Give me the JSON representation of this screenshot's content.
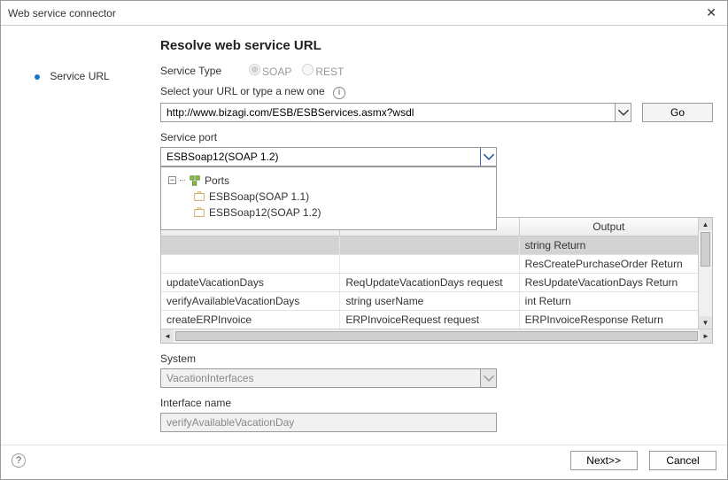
{
  "window": {
    "title": "Web service connector"
  },
  "nav": {
    "item0": "Service URL"
  },
  "section": {
    "title": "Resolve web service URL",
    "service_type_label": "Service Type",
    "service_type_options": {
      "soap": "SOAP",
      "rest": "REST"
    },
    "url_label": "Select your URL or type a new one",
    "url_value": "http://www.bizagi.com/ESB/ESBServices.asmx?wsdl",
    "go_label": "Go",
    "port_label": "Service port",
    "port_value": "ESBSoap12(SOAP 1.2)",
    "port_tree": {
      "root": "Ports",
      "items": [
        "ESBSoap(SOAP 1.1)",
        "ESBSoap12(SOAP 1.2)"
      ]
    },
    "table": {
      "columns": [
        "",
        "",
        "Output"
      ],
      "rows": [
        {
          "c0": "",
          "c1": "",
          "c2": "string Return",
          "selected": true
        },
        {
          "c0": "",
          "c1": "",
          "c2": "ResCreatePurchaseOrder Return"
        },
        {
          "c0": "updateVacationDays",
          "c1": "ReqUpdateVacationDays request",
          "c2": "ResUpdateVacationDays Return"
        },
        {
          "c0": "verifyAvailableVacationDays",
          "c1": "string userName",
          "c2": "int Return"
        },
        {
          "c0": "createERPInvoice",
          "c1": "ERPInvoiceRequest request",
          "c2": "ERPInvoiceResponse Return"
        }
      ]
    },
    "system_label": "System",
    "system_value": "VacationInterfaces",
    "interface_label": "Interface name",
    "interface_value": "verifyAvailableVacationDay"
  },
  "footer": {
    "next": "Next>>",
    "cancel": "Cancel"
  }
}
